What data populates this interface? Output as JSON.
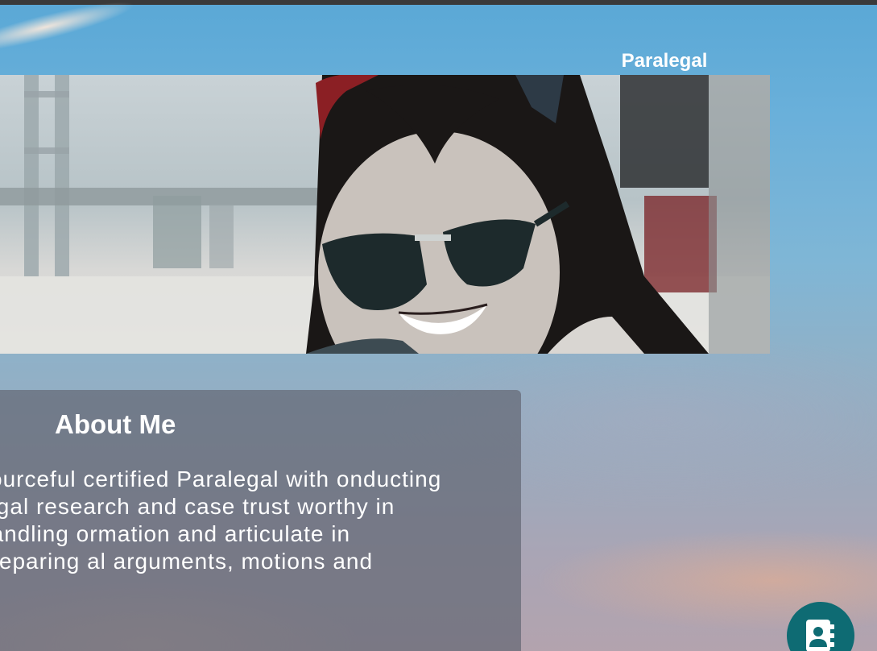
{
  "header": {
    "job_title": "Paralegal"
  },
  "hero": {
    "image_description": "portrait photo"
  },
  "about": {
    "heading": "About Me",
    "body": "sourceful certified Paralegal with onducting legal research and case trust worthy in handling ormation and articulate in preparing al arguments, motions and"
  },
  "contact_button": {
    "icon": "address-book-icon",
    "color": "#0e6b73"
  }
}
